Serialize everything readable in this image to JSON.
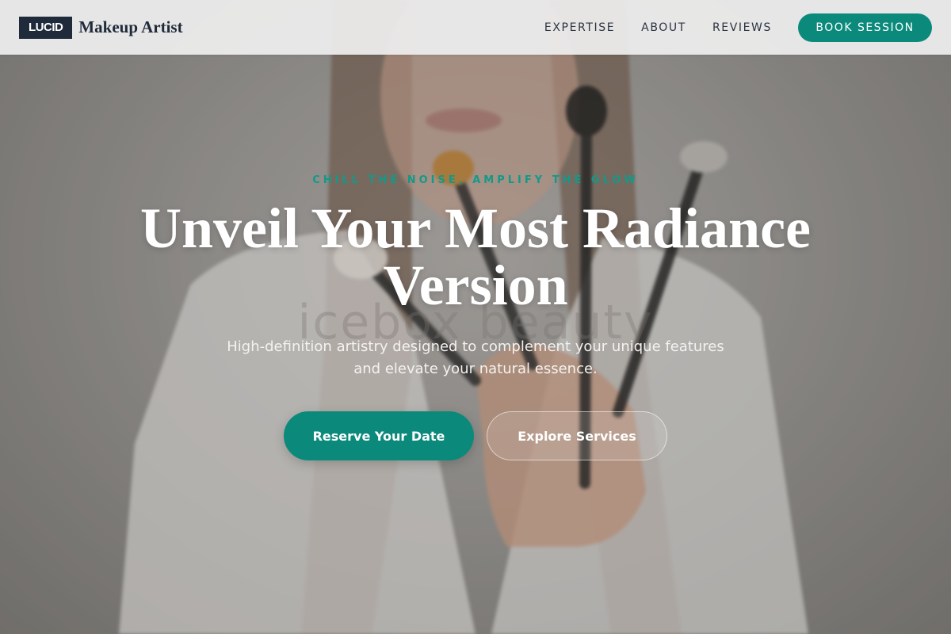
{
  "header": {
    "logo_mark": "LUCID",
    "brand_name": "Makeup Artist",
    "nav": [
      {
        "label": "EXPERTISE"
      },
      {
        "label": "ABOUT"
      },
      {
        "label": "REVIEWS"
      }
    ],
    "cta_label": "BOOK SESSION"
  },
  "hero": {
    "tagline": "CHILL THE NOISE, AMPLIFY THE GLOW",
    "headline": "Unveil Your Most Radiance Version",
    "subtext": "High-definition artistry designed to complement your unique features and elevate your natural essence.",
    "primary_button": "Reserve Your Date",
    "secondary_button": "Explore Services",
    "watermark": "icebox beauty"
  },
  "colors": {
    "accent": "#0b8a7c",
    "brand_dark": "#1f2a3a",
    "header_bg": "#ececec",
    "text_light": "#ffffff"
  },
  "icons": [
    "makeup-brushes-photo"
  ]
}
